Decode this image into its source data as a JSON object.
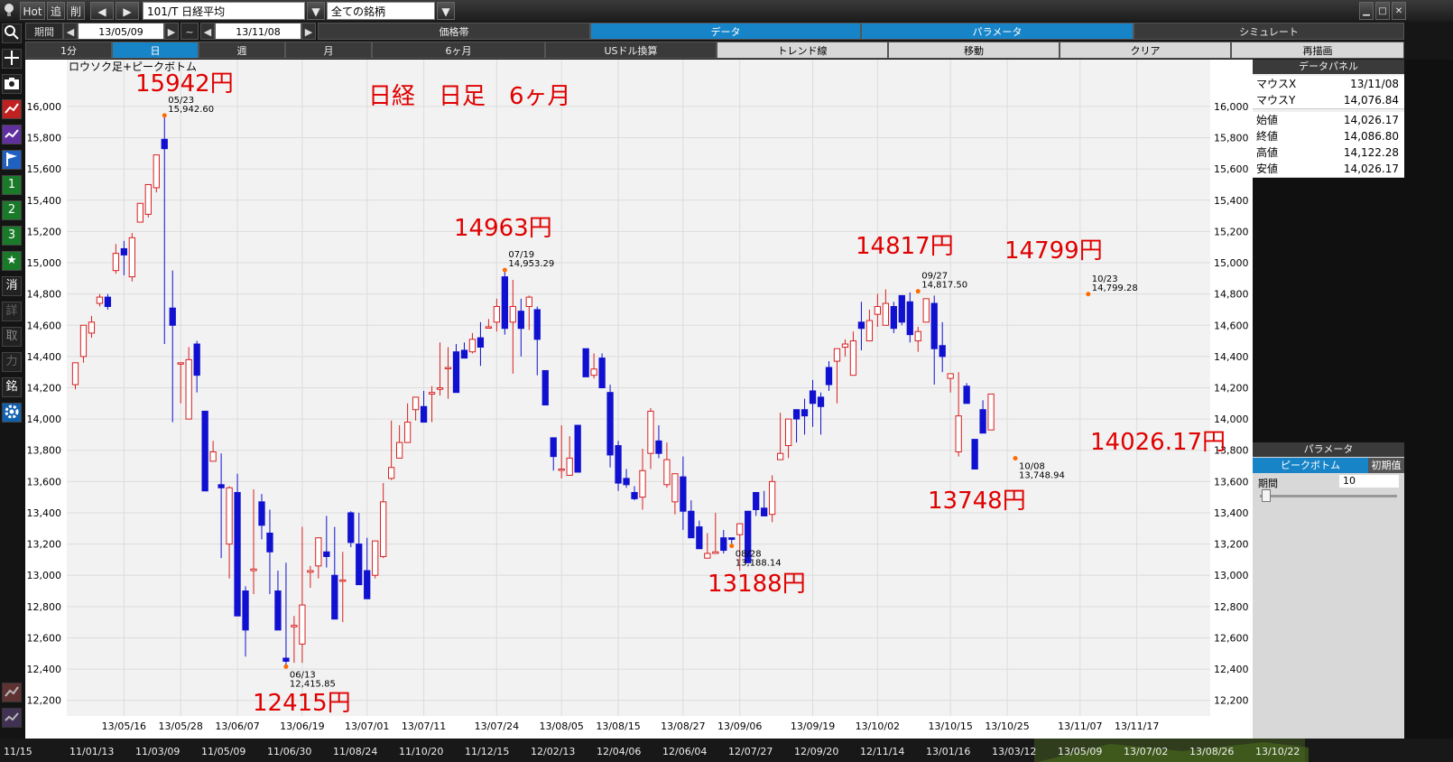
{
  "topbar": {
    "hot": "Hot",
    "add": "追",
    "del": "削",
    "symbol": "101/T 日経平均",
    "universe": "全ての銘柄"
  },
  "periodbar": {
    "label": "期間",
    "start": "13/05/09",
    "tilde": "~",
    "end": "13/11/08",
    "tabs": [
      "価格帯",
      "データ",
      "パラメータ",
      "シミュレート"
    ]
  },
  "intervalbar": {
    "items": [
      "1分",
      "日",
      "週",
      "月",
      "6ヶ月",
      "USドル換算",
      "トレンド線",
      "移動",
      "クリア",
      "再描画"
    ]
  },
  "sidebar": {
    "num1": "1",
    "num2": "2",
    "num3": "3",
    "star": "★",
    "c1": "消",
    "c2": "詳",
    "c3": "取",
    "c4": "力",
    "c5": "銘"
  },
  "data_panel": {
    "title": "データパネル",
    "rows": [
      {
        "k": "マウスX",
        "v": "13/11/08"
      },
      {
        "k": "マウスY",
        "v": "14,076.84"
      },
      {
        "k": "始値",
        "v": "14,026.17"
      },
      {
        "k": "終値",
        "v": "14,086.80"
      },
      {
        "k": "高値",
        "v": "14,122.28"
      },
      {
        "k": "安値",
        "v": "14,026.17"
      }
    ]
  },
  "param_panel": {
    "title": "パラメータ",
    "tab": "ピークボトム",
    "reset": "初期值",
    "period_label": "期間",
    "period_value": "10"
  },
  "annotations": {
    "title": "日経　日足　6ヶ月",
    "a1": "15942円",
    "a2": "14963円",
    "a3": "14817円",
    "a4": "14799円",
    "a5": "12415円",
    "a6": "13188円",
    "a7": "13748円",
    "a8": "14026.17円"
  },
  "bottom_nav": [
    "11/15",
    "11/01/13",
    "11/03/09",
    "11/05/09",
    "11/06/30",
    "11/08/24",
    "11/10/20",
    "11/12/15",
    "12/02/13",
    "12/04/06",
    "12/06/04",
    "12/07/27",
    "12/09/20",
    "12/11/14",
    "13/01/16",
    "13/03/12",
    "13/05/09",
    "13/07/02",
    "13/08/26",
    "13/10/22"
  ],
  "chart_data": {
    "type": "candlestick",
    "title": "ロウソク足+ピークボトム",
    "ylim": [
      12100,
      16300
    ],
    "yticks": [
      12200,
      12400,
      12600,
      12800,
      13000,
      13200,
      13400,
      13600,
      13800,
      14000,
      14200,
      14400,
      14600,
      14800,
      15000,
      15200,
      15400,
      15600,
      15800,
      16000
    ],
    "ytick_labels": [
      "12,200",
      "12,400",
      "12,600",
      "12,800",
      "13,000",
      "13,200",
      "13,400",
      "13,600",
      "13,800",
      "14,000",
      "14,200",
      "14,400",
      "14,600",
      "14,800",
      "15,000",
      "15,200",
      "15,400",
      "15,600",
      "15,800",
      "16,000"
    ],
    "xtick_labels": [
      "13/05/16",
      "13/05/28",
      "13/06/07",
      "13/06/19",
      "13/07/01",
      "13/07/11",
      "13/07/24",
      "13/08/05",
      "13/08/15",
      "13/08/27",
      "13/09/06",
      "13/09/19",
      "13/10/02",
      "13/10/15",
      "13/10/25",
      "13/11/07",
      "13/11/17"
    ],
    "xtick_index": [
      6,
      13,
      20,
      28,
      36,
      43,
      52,
      60,
      67,
      75,
      82,
      91,
      99,
      108,
      115,
      124,
      131
    ],
    "colors": {
      "up": "#d82020",
      "down": "#1010d0",
      "marker": "#ff6a00",
      "annotation": "#e00000"
    },
    "candles": [
      [
        14220,
        14360,
        14190,
        14360
      ],
      [
        14400,
        14600,
        14360,
        14600
      ],
      [
        14550,
        14660,
        14520,
        14620
      ],
      [
        14740,
        14800,
        14720,
        14780
      ],
      [
        14780,
        14800,
        14700,
        14720
      ],
      [
        14950,
        15120,
        14930,
        15060
      ],
      [
        15090,
        15140,
        14920,
        15050
      ],
      [
        14910,
        15190,
        14880,
        15160
      ],
      [
        15260,
        15380,
        15260,
        15380
      ],
      [
        15310,
        15480,
        15290,
        15500
      ],
      [
        15480,
        15690,
        15450,
        15690
      ],
      [
        15790,
        15942.6,
        14480,
        15730
      ],
      [
        14710,
        14950,
        13980,
        14600
      ],
      [
        14360,
        14330,
        14100,
        14360
      ],
      [
        14000,
        14460,
        14000,
        14380
      ],
      [
        14480,
        14500,
        14170,
        14280
      ],
      [
        14050,
        14050,
        13600,
        13540
      ],
      [
        13730,
        13860,
        13770,
        13790
      ],
      [
        13580,
        13780,
        13110,
        13560
      ],
      [
        13200,
        13570,
        12980,
        13560
      ],
      [
        13530,
        13650,
        12990,
        12740
      ],
      [
        12900,
        12930,
        12480,
        12650
      ],
      [
        13030,
        13550,
        12880,
        13040
      ],
      [
        13470,
        13520,
        13230,
        13320
      ],
      [
        13270,
        13420,
        12880,
        13150
      ],
      [
        12900,
        13030,
        12890,
        12650
      ],
      [
        12470,
        13080,
        12415.85,
        12450
      ],
      [
        12670,
        12740,
        12440,
        12680
      ],
      [
        12560,
        13310,
        12440,
        12810
      ],
      [
        13020,
        13060,
        12920,
        13030
      ],
      [
        13060,
        13210,
        12980,
        13240
      ],
      [
        13150,
        13380,
        13050,
        13120
      ],
      [
        13000,
        13310,
        12800,
        12720
      ],
      [
        12970,
        13150,
        12700,
        12970
      ],
      [
        13400,
        13410,
        13180,
        13210
      ],
      [
        13200,
        13400,
        13130,
        12940
      ],
      [
        13030,
        13240,
        12950,
        12850
      ],
      [
        13000,
        13210,
        12980,
        13220
      ],
      [
        13120,
        13590,
        13110,
        13470
      ],
      [
        13620,
        13990,
        13610,
        13690
      ],
      [
        13750,
        13960,
        13850,
        13850
      ],
      [
        13850,
        14100,
        13880,
        13980
      ],
      [
        14060,
        14130,
        13990,
        14140
      ],
      [
        14080,
        14180,
        14040,
        13980
      ],
      [
        14160,
        14210,
        13980,
        14170
      ],
      [
        14190,
        14490,
        14150,
        14200
      ],
      [
        14330,
        14460,
        14130,
        14330
      ],
      [
        14430,
        14480,
        14180,
        14170
      ],
      [
        14440,
        14490,
        14420,
        14390
      ],
      [
        14430,
        14550,
        14420,
        14510
      ],
      [
        14520,
        14620,
        14340,
        14460
      ],
      [
        14590,
        14640,
        14610,
        14590
      ],
      [
        14620,
        14770,
        14560,
        14720
      ],
      [
        14910,
        14953.29,
        14540,
        14580
      ],
      [
        14620,
        14890,
        14290,
        14720
      ],
      [
        14690,
        14770,
        14400,
        14580
      ],
      [
        14720,
        14790,
        14570,
        14780
      ],
      [
        14700,
        14720,
        14280,
        14510
      ],
      [
        14310,
        14310,
        14230,
        14090
      ],
      [
        13880,
        13830,
        13670,
        13760
      ],
      [
        13680,
        13960,
        13620,
        13680
      ],
      [
        13640,
        13890,
        13660,
        13750
      ],
      [
        13960,
        13950,
        13680,
        13660
      ],
      [
        14450,
        14450,
        14290,
        14270
      ],
      [
        14280,
        14420,
        14260,
        14320
      ],
      [
        14390,
        14420,
        14360,
        14200
      ],
      [
        14170,
        14220,
        13690,
        13770
      ],
      [
        13830,
        13860,
        13540,
        13590
      ],
      [
        13620,
        13680,
        13560,
        13580
      ],
      [
        13530,
        13570,
        13480,
        13490
      ],
      [
        13500,
        13810,
        13420,
        13670
      ],
      [
        13780,
        14070,
        13680,
        14050
      ],
      [
        13860,
        13960,
        13750,
        13780
      ],
      [
        13580,
        13850,
        13560,
        13740
      ],
      [
        13470,
        13650,
        13390,
        13650
      ],
      [
        13630,
        13760,
        13290,
        13410
      ],
      [
        13410,
        13480,
        13260,
        13240
      ],
      [
        13310,
        13350,
        13330,
        13170
      ],
      [
        13110,
        13270,
        13150,
        13140
      ],
      [
        13140,
        13400,
        13150,
        13150
      ],
      [
        13240,
        13290,
        13140,
        13160
      ],
      [
        13240,
        13130,
        13188.14,
        13230
      ],
      [
        13260,
        13330,
        13030,
        13330
      ],
      [
        13410,
        13390,
        13200,
        13080
      ],
      [
        13530,
        13440,
        13380,
        13420
      ],
      [
        13430,
        13540,
        13490,
        13380
      ],
      [
        13390,
        13640,
        13340,
        13600
      ]
    ],
    "markers": [
      {
        "i": 11,
        "value": 15942.6,
        "date": "05/23",
        "label": "15,942.60",
        "pos": "top"
      },
      {
        "i": 26,
        "value": 12415.85,
        "date": "06/13",
        "label": "12,415.85",
        "pos": "bottom"
      },
      {
        "i": 53,
        "value": 14953.29,
        "date": "07/19",
        "label": "14,953.29",
        "pos": "top"
      },
      {
        "i": 81,
        "value": 13188.14,
        "date": "08/28",
        "label": "13,188.14",
        "pos": "bottom"
      },
      {
        "i": 104,
        "value": 14817.5,
        "date": "09/27",
        "label": "14,817.50",
        "pos": "top"
      },
      {
        "i": 116,
        "value": 13748.94,
        "date": "10/08",
        "label": "13,748.94",
        "pos": "bottom"
      },
      {
        "i": 125,
        "value": 14799.28,
        "date": "10/23",
        "label": "14,799.28",
        "pos": "top"
      }
    ],
    "late_candles": [
      [
        13740,
        14040,
        13760,
        13780
      ],
      [
        13830,
        13750,
        13750,
        14000
      ],
      [
        14060,
        14000,
        13850,
        14000
      ],
      [
        14060,
        14130,
        13900,
        14020
      ],
      [
        14180,
        14250,
        13950,
        14100
      ],
      [
        14140,
        14170,
        13900,
        14080
      ],
      [
        14330,
        14370,
        14180,
        14220
      ],
      [
        14370,
        14450,
        14100,
        14450
      ],
      [
        14460,
        14510,
        14400,
        14480
      ],
      [
        14280,
        14560,
        14400,
        14500
      ],
      [
        14620,
        14750,
        14440,
        14580
      ],
      [
        14500,
        14700,
        14500,
        14630
      ],
      [
        14670,
        14800,
        14590,
        14720
      ],
      [
        14600,
        14830,
        14600,
        14740
      ],
      [
        14720,
        14750,
        14550,
        14580
      ],
      [
        14790,
        14640,
        14600,
        14620
      ],
      [
        14750,
        14810,
        14490,
        14540
      ],
      [
        14500,
        14590,
        14430,
        14560
      ],
      [
        14620,
        14760,
        14620,
        14770
      ],
      [
        14740,
        14790,
        14220,
        14450
      ],
      [
        14470,
        14620,
        14300,
        14400
      ],
      [
        14260,
        14270,
        14170,
        14290
      ],
      [
        13790,
        14300,
        13760,
        14020
      ],
      [
        14210,
        14230,
        14180,
        14100
      ],
      [
        13870,
        13870,
        13730,
        13680
      ],
      [
        14060,
        14120,
        14020,
        13910
      ],
      [
        13930,
        14160,
        13930,
        14160
      ]
    ]
  }
}
